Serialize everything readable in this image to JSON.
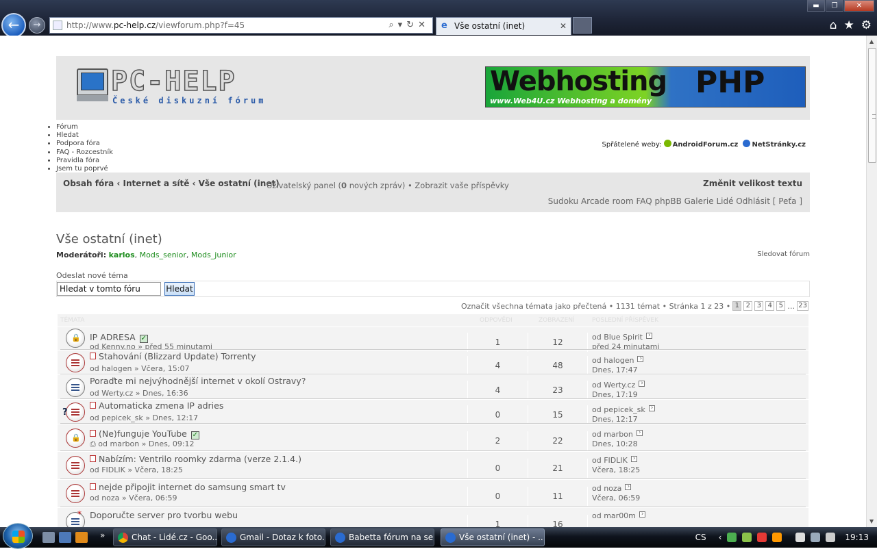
{
  "browser": {
    "url_prefix": "http://www.",
    "url_domain": "pc-help.cz",
    "url_path": "/viewforum.php?f=45",
    "tab_title": "Vše ostatní (inet)",
    "tab_close": "✕",
    "win_min": "▬",
    "win_max": "❐",
    "win_close": "✕",
    "back_glyph": "←",
    "fwd_glyph": "→",
    "addr_tools": "⌕▾↻✕",
    "home_glyph": "⌂",
    "fav_glyph": "★",
    "gear_glyph": "⚙"
  },
  "header": {
    "logo_title": "PC-HELP",
    "logo_subtitle": "České diskuzní fórum",
    "banner_main": "Webhosting",
    "banner_php": "PHP",
    "banner_small": "www.Web4U.cz  Webhosting a domény"
  },
  "nav_links": [
    "Fórum",
    "Hledat",
    "Podpora fóra",
    "FAQ - Rozcestník",
    "Pravidla fóra",
    "Jsem tu poprvé"
  ],
  "friends": {
    "label": "Spřátelené weby:",
    "site1": "AndroidForum.cz",
    "site2": "NetStránky.cz"
  },
  "navbar": {
    "crumbs": "Obsah fóra ‹ Internet a sítě ‹ Vše ostatní (inet)",
    "user_panel_pre": "Uživatelský panel (",
    "new_count": "0",
    "user_panel_post": " nových zpráv) • Zobrazit vaše příspěvky",
    "font_size": "Změnit velikost textu",
    "links": "Sudoku  Arcade room  FAQ phpBB  Galerie  Lidé  Odhlásit [ Peťa ]"
  },
  "forum": {
    "title": "Vše ostatní (inet)",
    "moderators_label": "Moderátoři:",
    "mod1": "karlos",
    "mod2": "Mods_senior",
    "mod3": "Mods_junior",
    "follow": "Sledovat fórum",
    "new_topic": "Odeslat nové téma",
    "search_placeholder": "Hledat v tomto fóru",
    "search_button": "Hledat",
    "pagination_text": "Označit všechna témata jako přečtená • 1131 témat • Stránka 1 z 23 •",
    "pages": [
      "1",
      "2",
      "3",
      "4",
      "5"
    ],
    "ellipsis": "…",
    "last_page": "23"
  },
  "table_headers": {
    "topics": "TÉMATA",
    "replies": "ODPOVĚDI",
    "views": "ZOBRAZENÍ",
    "last_post": "POSLEDNÍ PŘÍSPĚVEK"
  },
  "topics": [
    {
      "title": "IP ADRESA",
      "by": "od Kenny.no » před 55 minutami",
      "replies": "1",
      "views": "12",
      "last_by": "od Blue Spirit",
      "last_time": "před 24 minutami"
    },
    {
      "title": "Stahování (Blizzard Update) Torrenty",
      "by": "od halogen » Včera, 15:07",
      "replies": "4",
      "views": "48",
      "last_by": "od halogen",
      "last_time": "Dnes, 17:47"
    },
    {
      "title": "Poraďte mi nejvýhodnější internet v okolí Ostravy?",
      "by": "od Werty.cz » Dnes, 16:36",
      "replies": "4",
      "views": "23",
      "last_by": "od Werty.cz",
      "last_time": "Dnes, 17:19"
    },
    {
      "title": "Automaticka zmena IP adries",
      "by": "od pepicek_sk » Dnes, 12:17",
      "replies": "0",
      "views": "15",
      "last_by": "od pepicek_sk",
      "last_time": "Dnes, 12:17"
    },
    {
      "title": "(Ne)funguje YouTube",
      "by": "od marbon » Dnes, 09:12",
      "replies": "2",
      "views": "22",
      "last_by": "od marbon",
      "last_time": "Dnes, 10:28"
    },
    {
      "title": "Nabízím: Ventrilo roomky zdarma (verze 2.1.4.)",
      "by": "od FIDLIK » Včera, 18:25",
      "replies": "0",
      "views": "21",
      "last_by": "od FIDLIK",
      "last_time": "Včera, 18:25"
    },
    {
      "title": "nejde připojit internet do samsung smart tv",
      "by": "od noza » Včera, 06:59",
      "replies": "0",
      "views": "11",
      "last_by": "od noza",
      "last_time": "Včera, 06:59"
    },
    {
      "title": "Doporučte server pro tvorbu webu",
      "by": "",
      "replies": "1",
      "views": "16",
      "last_by": "od mar00m",
      "last_time": ""
    }
  ],
  "taskbar": {
    "tasks": [
      "Chat - Lidé.cz - Goo...",
      "Gmail - Dotaz k foto...",
      "Babetta fórum na se...",
      "Vše ostatní (inet) - ..."
    ],
    "more": "»",
    "lang": "CS",
    "tray_arrow": "‹",
    "clock": "19:13"
  }
}
